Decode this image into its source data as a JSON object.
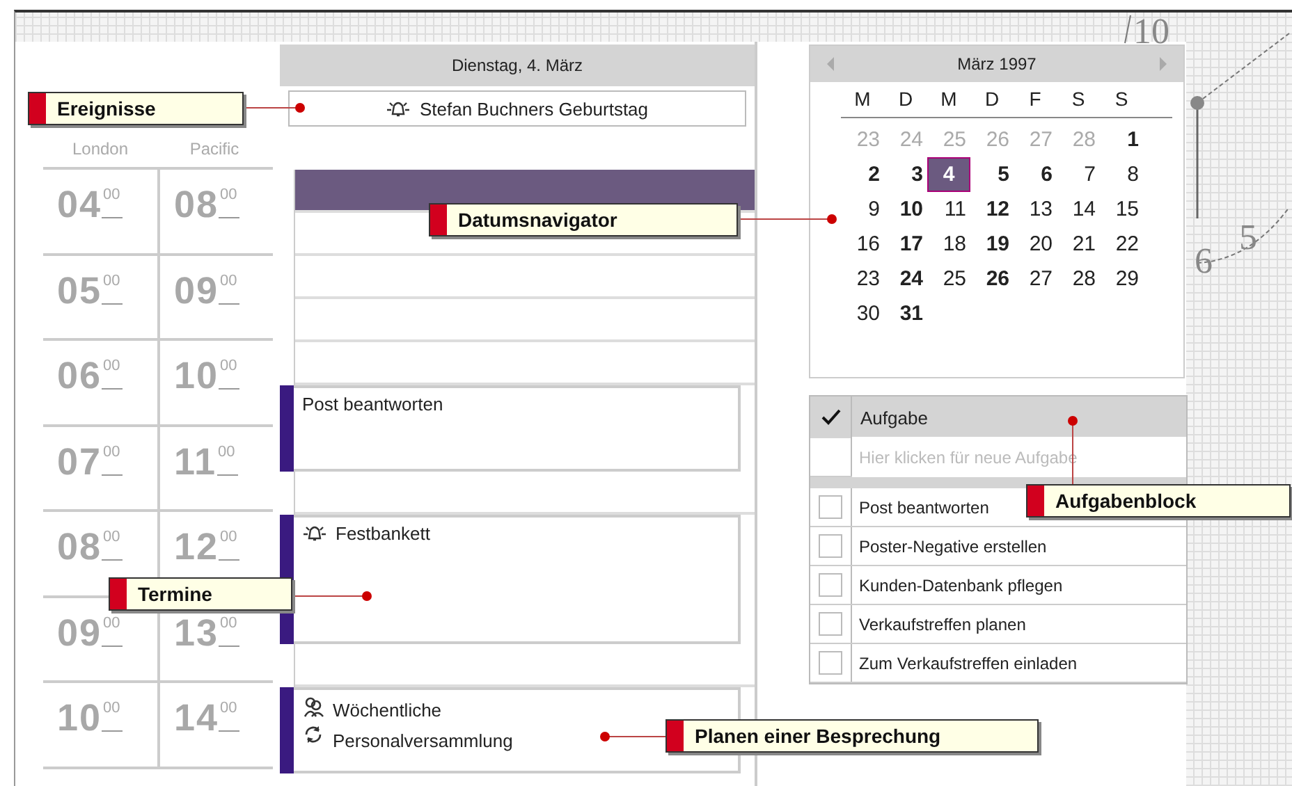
{
  "time_zones": [
    {
      "label": "London"
    },
    {
      "label": "Pacific"
    }
  ],
  "hours": [
    {
      "london": {
        "hour": "04",
        "minutes": "00"
      },
      "pacific": {
        "hour": "08",
        "minutes": "00"
      }
    },
    {
      "london": {
        "hour": "05",
        "minutes": "00"
      },
      "pacific": {
        "hour": "09",
        "minutes": "00"
      }
    },
    {
      "london": {
        "hour": "06",
        "minutes": "00"
      },
      "pacific": {
        "hour": "10",
        "minutes": "00"
      }
    },
    {
      "london": {
        "hour": "07",
        "minutes": "00"
      },
      "pacific": {
        "hour": "11",
        "minutes": "00"
      }
    },
    {
      "london": {
        "hour": "08",
        "minutes": "00"
      },
      "pacific": {
        "hour": "12",
        "minutes": "00"
      }
    },
    {
      "london": {
        "hour": "09",
        "minutes": "00"
      },
      "pacific": {
        "hour": "13",
        "minutes": "00"
      }
    },
    {
      "london": {
        "hour": "10",
        "minutes": "00"
      },
      "pacific": {
        "hour": "14",
        "minutes": "00"
      }
    }
  ],
  "day_view": {
    "date": "Dienstag, 4. März",
    "all_day_events": [
      {
        "title": "Stefan Buchners Geburtstag",
        "reminder": true
      }
    ],
    "rows": [
      {
        "kind": "slot",
        "selected": true
      },
      {
        "kind": "slot",
        "selected": false
      },
      {
        "kind": "slot",
        "selected": false
      },
      {
        "kind": "slot",
        "selected": false
      },
      {
        "kind": "slot",
        "selected": false
      },
      {
        "kind": "appointment",
        "title": "Post beantworten",
        "reminder": false,
        "meeting": false,
        "recurring": false
      },
      {
        "kind": "slot",
        "selected": false
      },
      {
        "kind": "appointment",
        "title": "Festbankett",
        "reminder": true,
        "meeting": false,
        "recurring": false
      },
      {
        "kind": "slot",
        "selected": false
      },
      {
        "kind": "appointment",
        "title": "Wöchentliche Personalversammlung",
        "reminder": false,
        "meeting": true,
        "recurring": true
      }
    ]
  },
  "date_navigator": {
    "month": "März 1997",
    "weekdays": [
      "M",
      "D",
      "M",
      "D",
      "F",
      "S",
      "S"
    ],
    "weeks": [
      [
        {
          "day": "23",
          "muted": true,
          "bold": false,
          "selected": false
        },
        {
          "day": "24",
          "muted": true,
          "bold": false,
          "selected": false
        },
        {
          "day": "25",
          "muted": true,
          "bold": false,
          "selected": false
        },
        {
          "day": "26",
          "muted": true,
          "bold": false,
          "selected": false
        },
        {
          "day": "27",
          "muted": true,
          "bold": false,
          "selected": false
        },
        {
          "day": "28",
          "muted": true,
          "bold": false,
          "selected": false
        },
        {
          "day": "1",
          "muted": false,
          "bold": true,
          "selected": false
        }
      ],
      [
        {
          "day": "2",
          "muted": false,
          "bold": true,
          "selected": false
        },
        {
          "day": "3",
          "muted": false,
          "bold": true,
          "selected": false
        },
        {
          "day": "4",
          "muted": false,
          "bold": true,
          "selected": true
        },
        {
          "day": "5",
          "muted": false,
          "bold": true,
          "selected": false
        },
        {
          "day": "6",
          "muted": false,
          "bold": true,
          "selected": false
        },
        {
          "day": "7",
          "muted": false,
          "bold": false,
          "selected": false
        },
        {
          "day": "8",
          "muted": false,
          "bold": false,
          "selected": false
        }
      ],
      [
        {
          "day": "9",
          "muted": false,
          "bold": false,
          "selected": false
        },
        {
          "day": "10",
          "muted": false,
          "bold": true,
          "selected": false
        },
        {
          "day": "11",
          "muted": false,
          "bold": false,
          "selected": false
        },
        {
          "day": "12",
          "muted": false,
          "bold": true,
          "selected": false
        },
        {
          "day": "13",
          "muted": false,
          "bold": false,
          "selected": false
        },
        {
          "day": "14",
          "muted": false,
          "bold": false,
          "selected": false
        },
        {
          "day": "15",
          "muted": false,
          "bold": false,
          "selected": false
        }
      ],
      [
        {
          "day": "16",
          "muted": false,
          "bold": false,
          "selected": false
        },
        {
          "day": "17",
          "muted": false,
          "bold": true,
          "selected": false
        },
        {
          "day": "18",
          "muted": false,
          "bold": false,
          "selected": false
        },
        {
          "day": "19",
          "muted": false,
          "bold": true,
          "selected": false
        },
        {
          "day": "20",
          "muted": false,
          "bold": false,
          "selected": false
        },
        {
          "day": "21",
          "muted": false,
          "bold": false,
          "selected": false
        },
        {
          "day": "22",
          "muted": false,
          "bold": false,
          "selected": false
        }
      ],
      [
        {
          "day": "23",
          "muted": false,
          "bold": false,
          "selected": false
        },
        {
          "day": "24",
          "muted": false,
          "bold": true,
          "selected": false
        },
        {
          "day": "25",
          "muted": false,
          "bold": false,
          "selected": false
        },
        {
          "day": "26",
          "muted": false,
          "bold": true,
          "selected": false
        },
        {
          "day": "27",
          "muted": false,
          "bold": false,
          "selected": false
        },
        {
          "day": "28",
          "muted": false,
          "bold": false,
          "selected": false
        },
        {
          "day": "29",
          "muted": false,
          "bold": false,
          "selected": false
        }
      ],
      [
        {
          "day": "30",
          "muted": false,
          "bold": false,
          "selected": false
        },
        {
          "day": "31",
          "muted": false,
          "bold": true,
          "selected": false
        }
      ]
    ]
  },
  "task_pad": {
    "header": "Aufgabe",
    "header_checked": true,
    "new_task": {
      "placeholder": "Hier klicken für neue Aufgabe"
    },
    "tasks": [
      {
        "title": "Post beantworten",
        "checked": false
      },
      {
        "title": "Poster-Negative erstellen",
        "checked": false
      },
      {
        "title": "Kunden-Datenbank pflegen",
        "checked": false
      },
      {
        "title": "Verkaufstreffen planen",
        "checked": false
      },
      {
        "title": "Zum Verkaufstreffen einladen",
        "checked": false
      }
    ]
  },
  "clock_numerals": [
    "10",
    "6",
    "5"
  ],
  "callouts": [
    {
      "label": "Ereignisse"
    },
    {
      "label": "Datumsnavigator"
    },
    {
      "label": "Termine"
    },
    {
      "label": "Aufgabenblock"
    },
    {
      "label": "Planen einer Besprechung"
    }
  ]
}
